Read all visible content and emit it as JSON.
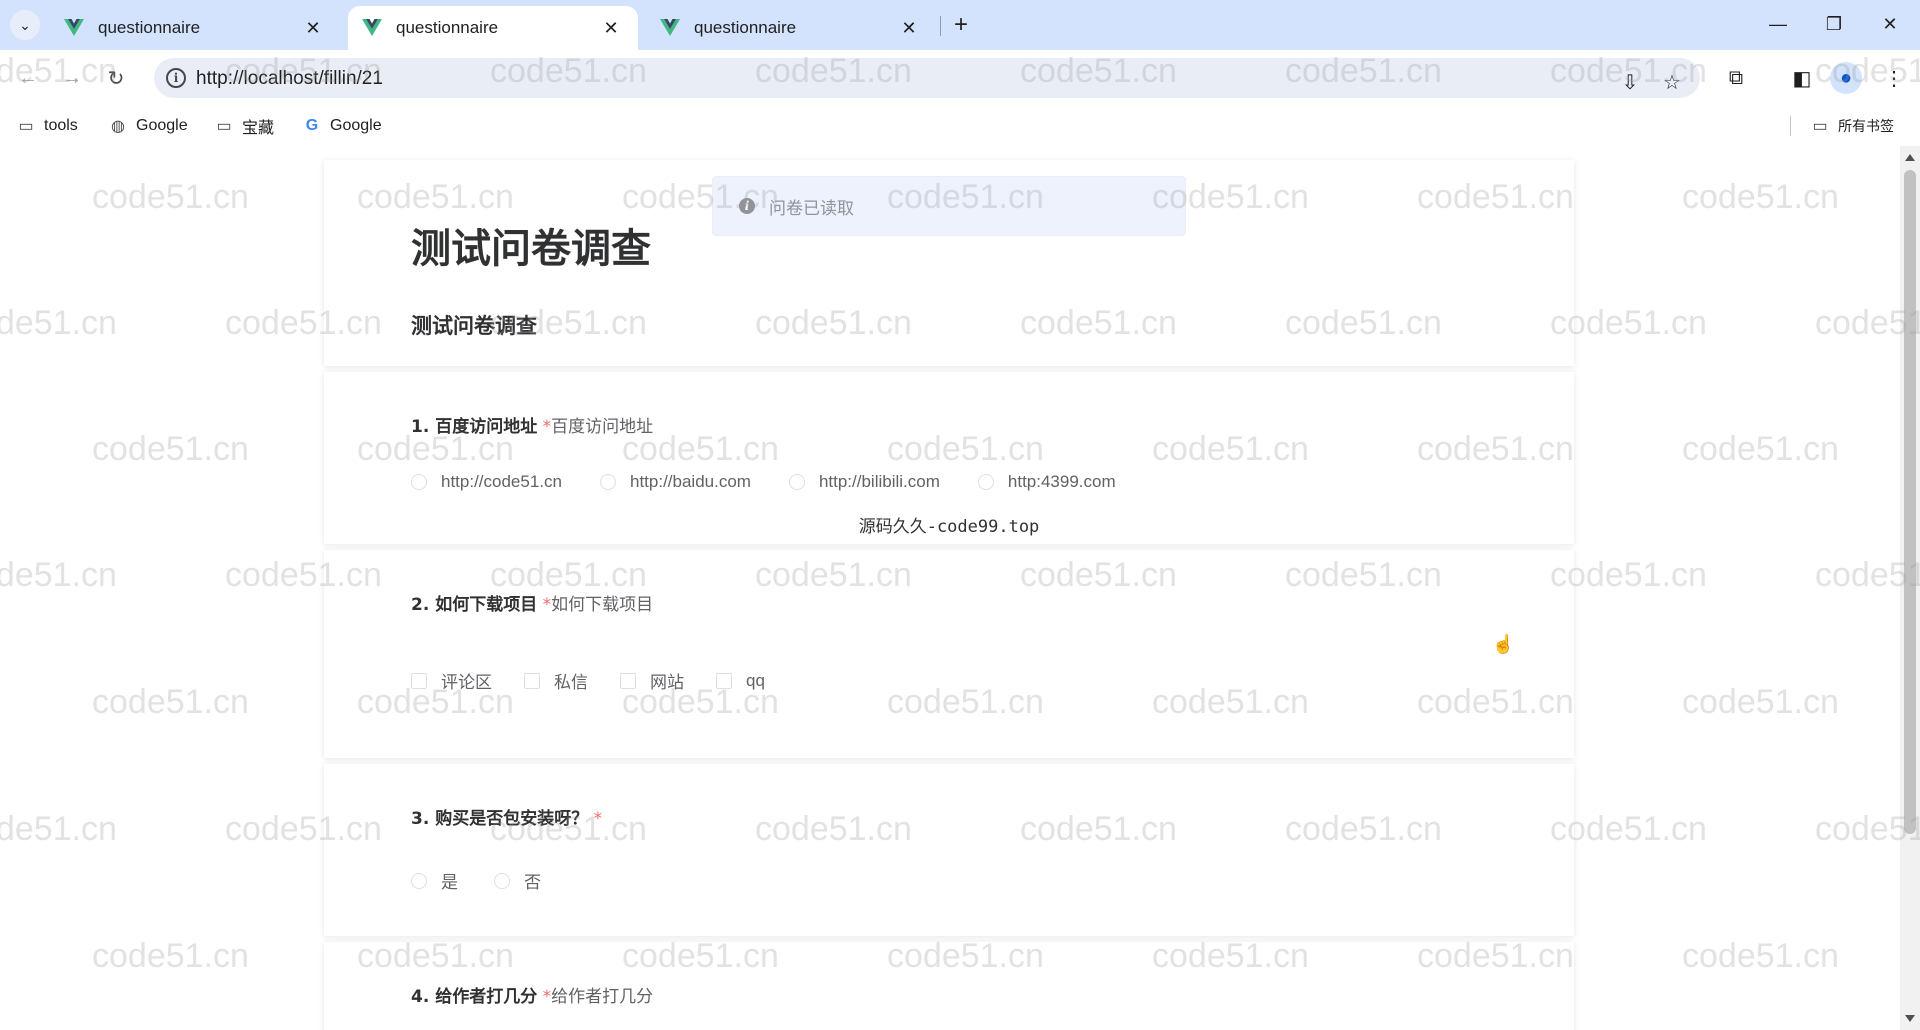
{
  "browser": {
    "tabs": [
      {
        "title": "questionnaire",
        "active": false
      },
      {
        "title": "questionnaire",
        "active": true
      },
      {
        "title": "questionnaire",
        "active": false
      }
    ],
    "tab_close_glyph": "✕",
    "new_tab_glyph": "+",
    "url": "http://localhost/fillin/21",
    "bookmarks": [
      {
        "label": "tools",
        "icon": "folder-icon"
      },
      {
        "label": "Google",
        "icon": "globe-icon"
      },
      {
        "label": "宝藏",
        "icon": "folder-icon"
      },
      {
        "label": "Google",
        "icon": "google-g-icon"
      }
    ],
    "all_bookmarks_label": "所有书签",
    "colors": {
      "tabstrip": "#d3e3fd",
      "omnibox": "#e9eef6",
      "vue_green": "#41b883",
      "vue_dark": "#35495e"
    }
  },
  "message": {
    "text": "问卷已读取",
    "icon": "info-icon"
  },
  "survey": {
    "title": "测试问卷调查",
    "subtitle": "测试问卷调查",
    "questions": [
      {
        "number": "1. 百度访问地址",
        "required_mark": " *",
        "description": "百度访问地址",
        "type": "radio",
        "options": [
          "http://code51.cn",
          "http://baidu.com",
          "http://bilibili.com",
          "http:4399.com"
        ]
      },
      {
        "number": "2. 如何下载项目",
        "required_mark": " *",
        "description": "如何下载项目",
        "type": "checkbox",
        "options": [
          "评论区",
          "私信",
          "网站",
          "qq"
        ]
      },
      {
        "number": "3. 购买是否包安装呀？",
        "required_mark": " *",
        "description": "",
        "type": "radio",
        "options": [
          "是",
          "否"
        ]
      },
      {
        "number": "4. 给作者打几分",
        "required_mark": " *",
        "description": "给作者打几分",
        "type": "rate",
        "options": []
      }
    ],
    "source_note": "源码久久-code99.top"
  },
  "watermark_text": "code51.cn"
}
